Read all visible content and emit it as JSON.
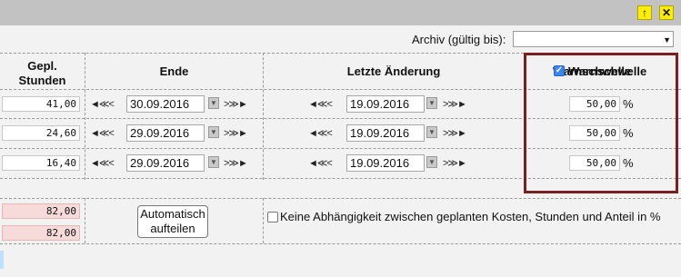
{
  "toolbar": {
    "up_icon": "arrow-up-icon",
    "close_icon": "close-icon"
  },
  "archive": {
    "label": "Archiv (gültig bis):",
    "value": ""
  },
  "columns": {
    "gepl_line1": "Gepl.",
    "gepl_line2": "Stunden",
    "ende": "Ende",
    "letzte": "Letzte Änderung",
    "warn": "Warnschwelle"
  },
  "nav": {
    "back": "◄≪<",
    "forward": ">≫►"
  },
  "rows": [
    {
      "stunden": "41,00",
      "ende": "30.09.2016",
      "letzte": "19.09.2016",
      "warn": "50,00",
      "unit": "%"
    },
    {
      "stunden": "24,60",
      "ende": "29.09.2016",
      "letzte": "19.09.2016",
      "warn": "50,00",
      "unit": "%"
    },
    {
      "stunden": "16,40",
      "ende": "29.09.2016",
      "letzte": "19.09.2016",
      "warn": "50,00",
      "unit": "%"
    }
  ],
  "summary": {
    "total1": "82,00",
    "total2": "82,00",
    "auto_line1": "Automatisch",
    "auto_line2": "aufteilen",
    "dependency": "Keine Abhängigkeit zwischen geplanten Kosten, Stunden und Anteil in %"
  },
  "colors": {
    "highlight_border": "#7a1f1f",
    "checkbox_blue": "#3a86f0",
    "error_bg": "#f7dada"
  }
}
